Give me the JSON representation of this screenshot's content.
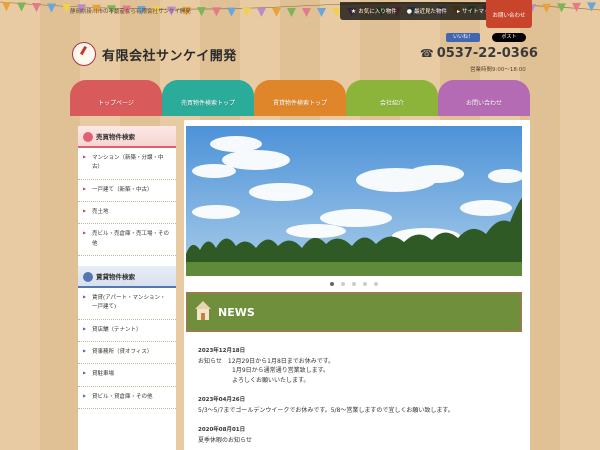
{
  "top": {
    "tagline": "静岡県掛川市の不動産なら有限会社サンケイ開発",
    "links": [
      {
        "icon": "star-icon",
        "glyph": "★",
        "label": "お気に入り物件"
      },
      {
        "icon": "history-icon",
        "glyph": "●",
        "label": "最近見た物件"
      },
      {
        "icon": "sitemap-icon",
        "glyph": "▸",
        "label": "サイトマップ"
      }
    ],
    "contact_label": "お問い合わせ"
  },
  "header": {
    "site_title": "有限会社サンケイ開発",
    "phone": "0537-22-0366",
    "hours": "営業時間9:00～18:00",
    "fb_like": "いいね！",
    "x_post": "ポスト"
  },
  "nav": {
    "items": [
      {
        "label": "トップページ",
        "color": "#d95a5a"
      },
      {
        "label": "売買物件検索トップ",
        "color": "#2bab9a"
      },
      {
        "label": "賃貸物件検索トップ",
        "color": "#e0862a"
      },
      {
        "label": "会社紹介",
        "color": "#8db43a"
      },
      {
        "label": "お問い合わせ",
        "color": "#b46bb3"
      }
    ]
  },
  "sidebar": {
    "sale_heading": "売買物件検索",
    "sale_items": [
      "マンション（新築・分譲・中古）",
      "一戸建て（新築・中古）",
      "売土地",
      "売ビル・売倉庫・売工場・その他"
    ],
    "rent_heading": "賃貸物件検索",
    "rent_items": [
      "賃貸(アパート・マンション・一戸建て)",
      "貸店舗（テナント）",
      "貸事務所（貸オフィス）",
      "貸駐車場",
      "貸ビル・貸倉庫・その他"
    ]
  },
  "slider": {
    "dot_count": 5,
    "active_index": 0
  },
  "news": {
    "heading": "NEWS",
    "entries": [
      {
        "date": "2023年12月18日",
        "lines": [
          "お知らせ　12月29日から1月8日までお休みです。",
          "1月9日から通常通り営業致します。",
          "よろしくお願いいたします。"
        ]
      },
      {
        "date": "2023年04月26日",
        "lines": [
          "5/3～5/7までゴールデンウイークでお休みです。5/8～営業しますので宜しくお願い致します。"
        ]
      },
      {
        "date": "2020年08月01日",
        "lines": [
          "夏季休暇のお知らせ"
        ]
      }
    ]
  }
}
